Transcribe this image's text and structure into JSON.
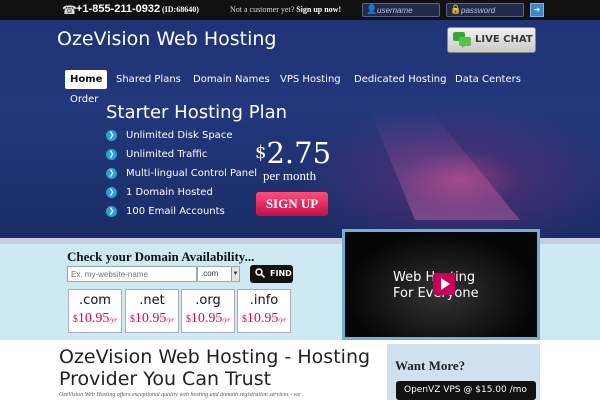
{
  "topbar": {
    "phone": "+1-855-211-0932",
    "phone_id": "(ID:68640)",
    "not_customer": "Not a customer yet?",
    "signup_link": "Sign up now!",
    "username_placeholder": "username",
    "password_placeholder": "password"
  },
  "header": {
    "site_title": "OzeVision Web Hosting",
    "live_chat": "LIVE CHAT"
  },
  "nav": {
    "items": [
      "Home",
      "Shared Plans",
      "Domain Names",
      "VPS Hosting",
      "Dedicated Hosting",
      "Data Centers"
    ],
    "order": "Order"
  },
  "hero": {
    "title": "Starter Hosting Plan",
    "features": [
      "Unlimited Disk Space",
      "Unlimited Traffic",
      "Multi-lingual Control Panel",
      "1 Domain Hosted",
      "100 Email Accounts"
    ],
    "currency": "$",
    "price": "2.75",
    "per": "per month",
    "signup": "SIGN UP"
  },
  "domain": {
    "title": "Check your Domain Availability...",
    "input_placeholder": "Ex. my-website-name",
    "tld_selected": ".com",
    "find_label": "FIND",
    "tlds": [
      {
        "ext": ".com",
        "currency": "$",
        "price": "10.95",
        "per": "/yr"
      },
      {
        "ext": ".net",
        "currency": "$",
        "price": "10.95",
        "per": "/yr"
      },
      {
        "ext": ".org",
        "currency": "$",
        "price": "10.95",
        "per": "/yr"
      },
      {
        "ext": ".info",
        "currency": "$",
        "price": "10.95",
        "per": "/yr"
      }
    ]
  },
  "video": {
    "line1": "Web Hosting",
    "line2": "For Everyone"
  },
  "main": {
    "heading": "OzeVision Web Hosting - Hosting Provider You Can Trust",
    "intro": "OzeVision Web Hosting offers exceptional quality web hosting and domain registration services - we"
  },
  "sidebar": {
    "title": "Want More?",
    "offer": "OpenVZ VPS @ $15.00 /mo"
  },
  "colors": {
    "header_blue": "#22387c",
    "accent_pink": "#e5004f",
    "topbar": "#111111"
  }
}
